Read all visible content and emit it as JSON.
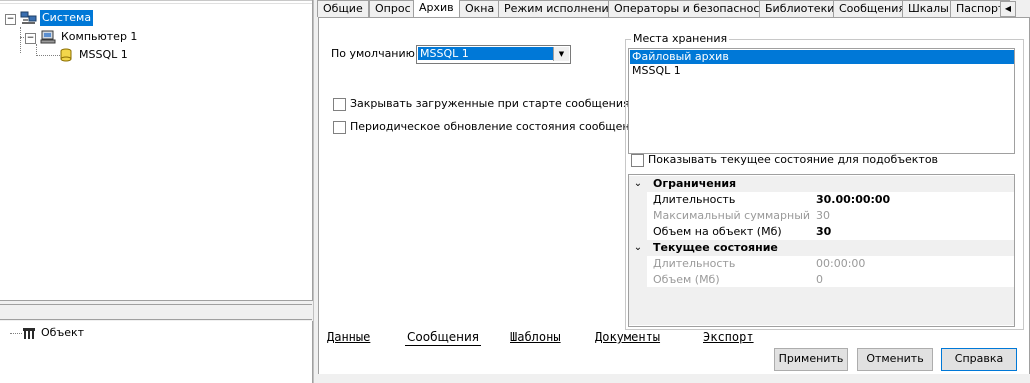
{
  "tree": {
    "items": [
      {
        "label": "Система",
        "icon": "network-computers-icon",
        "expander": "−",
        "selected": true
      },
      {
        "label": "Компьютер 1",
        "icon": "computer-icon",
        "expander": "−"
      },
      {
        "label": "MSSQL 1",
        "icon": "database-icon"
      }
    ]
  },
  "properties": {
    "items": [
      {
        "label": "Объект",
        "icon": "object-icon"
      }
    ]
  },
  "tabs": [
    {
      "label": "Общие"
    },
    {
      "label": "Опрос"
    },
    {
      "label": "Архив",
      "active": true
    },
    {
      "label": "Окна"
    },
    {
      "label": "Режим исполнения"
    },
    {
      "label": "Операторы и безопасность"
    },
    {
      "label": "Библиотеки"
    },
    {
      "label": "Сообщения"
    },
    {
      "label": "Шкалы"
    },
    {
      "label": "Паспорт"
    }
  ],
  "tab_scroll_icon": "◀",
  "archive": {
    "default_label": "По умолчанию",
    "default_value": "MSSQL 1",
    "checkboxes": [
      {
        "label": "Закрывать загруженные при старте сообщения",
        "checked": false
      },
      {
        "label": "Периодическое обновление состояния сообщений",
        "checked": false
      }
    ],
    "storage_title": "Места хранения",
    "storage_items": [
      {
        "label": "Файловый архив",
        "selected": true
      },
      {
        "label": "MSSQL 1",
        "selected": false
      }
    ],
    "show_state_label": "Показывать текущее состояние для подобъектов",
    "grid": [
      {
        "kind": "category",
        "name": "Ограничения"
      },
      {
        "kind": "prop",
        "name": "Длительность",
        "value": "30.00:00:00",
        "state": "bold"
      },
      {
        "kind": "prop",
        "name": "Максимальный суммарный об",
        "value": "30",
        "state": "disabled"
      },
      {
        "kind": "prop",
        "name": "Объем на объект (Мб)",
        "value": "30",
        "state": "bold"
      },
      {
        "kind": "category",
        "name": "Текущее состояние"
      },
      {
        "kind": "prop",
        "name": "Длительность",
        "value": "00:00:00",
        "state": "disabled"
      },
      {
        "kind": "prop",
        "name": "Объем (Мб)",
        "value": "0",
        "state": "disabled"
      }
    ]
  },
  "bottom_tabs": [
    {
      "label": "Данные"
    },
    {
      "label": "Сообщения",
      "active": true
    },
    {
      "label": "Шаблоны"
    },
    {
      "label": "Документы"
    },
    {
      "label": "Экспорт"
    }
  ],
  "buttons": {
    "apply": "Применить",
    "cancel": "Отменить",
    "help": "Справка"
  },
  "colors": {
    "selection": "#0078d7",
    "window_bg": "#f0f0f0"
  }
}
